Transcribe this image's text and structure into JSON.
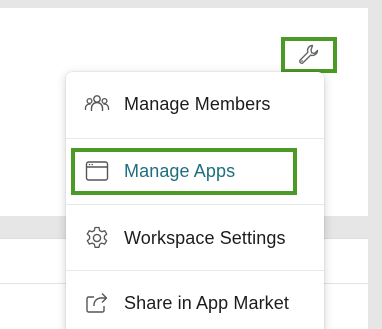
{
  "toolbar": {
    "wrench_icon": "wrench-icon",
    "highlight_color": "#4c9a26"
  },
  "menu": {
    "items": [
      {
        "label": "Manage Members",
        "icon": "members-icon"
      },
      {
        "label": "Manage Apps",
        "icon": "app-window-icon",
        "highlighted": true
      },
      {
        "label": "Workspace Settings",
        "icon": "gear-icon"
      },
      {
        "label": "Share in App Market",
        "icon": "share-icon"
      }
    ],
    "highlight_text_color": "#1f6e7e"
  }
}
